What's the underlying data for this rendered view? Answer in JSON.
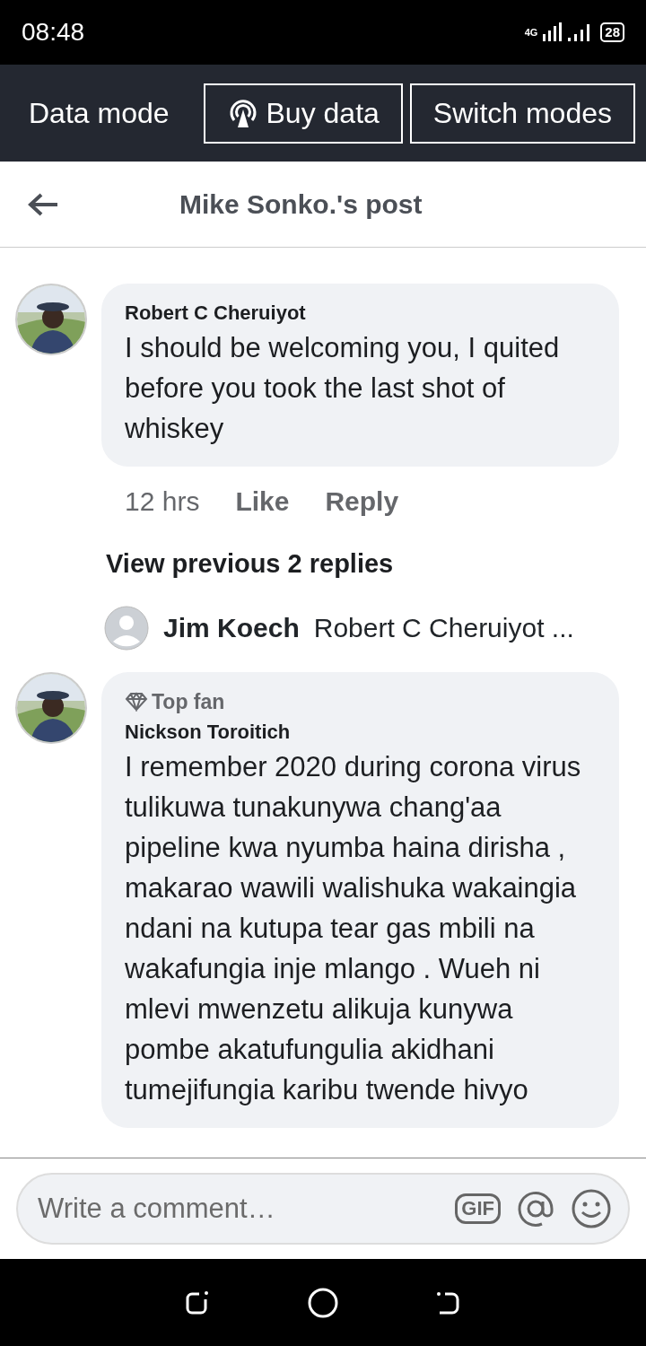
{
  "status_bar": {
    "time": "08:48",
    "network": "4G",
    "battery": "28"
  },
  "data_mode_bar": {
    "label": "Data mode",
    "buttons": [
      {
        "label": "Buy data",
        "kind": "buy"
      },
      {
        "label": "Switch modes",
        "kind": "plain"
      }
    ]
  },
  "header": {
    "title": "Mike Sonko.'s post"
  },
  "items": [
    {
      "kind": "comment",
      "author": "Robert C Cheruiyot",
      "text": "I should be welcoming you, I quited before you took the last shot of whiskey",
      "time": "12 hrs",
      "actions": [
        "Like",
        "Reply"
      ]
    },
    {
      "kind": "more",
      "label": "View previous 2 replies"
    },
    {
      "kind": "reply_preview",
      "author": "Jim Koech",
      "text": "Robert C Cheruiyot ..."
    },
    {
      "kind": "comment",
      "badge": "Top fan",
      "author": "Nickson Toroitich",
      "text": "I remember 2020 during corona virus tulikuwa tunakunywa chang'aa pipeline kwa nyumba haina dirisha , makarao wawili walishuka wakaingia ndani na kutupa tear gas mbili na wakafungia inje mlango . Wueh ni mlevi mwenzetu alikuja kunywa pombe akatufungulia akidhani tumejifungia karibu twende hivyo"
    }
  ],
  "composer": {
    "placeholder": "Write a comment…",
    "gif_label": "GIF"
  }
}
